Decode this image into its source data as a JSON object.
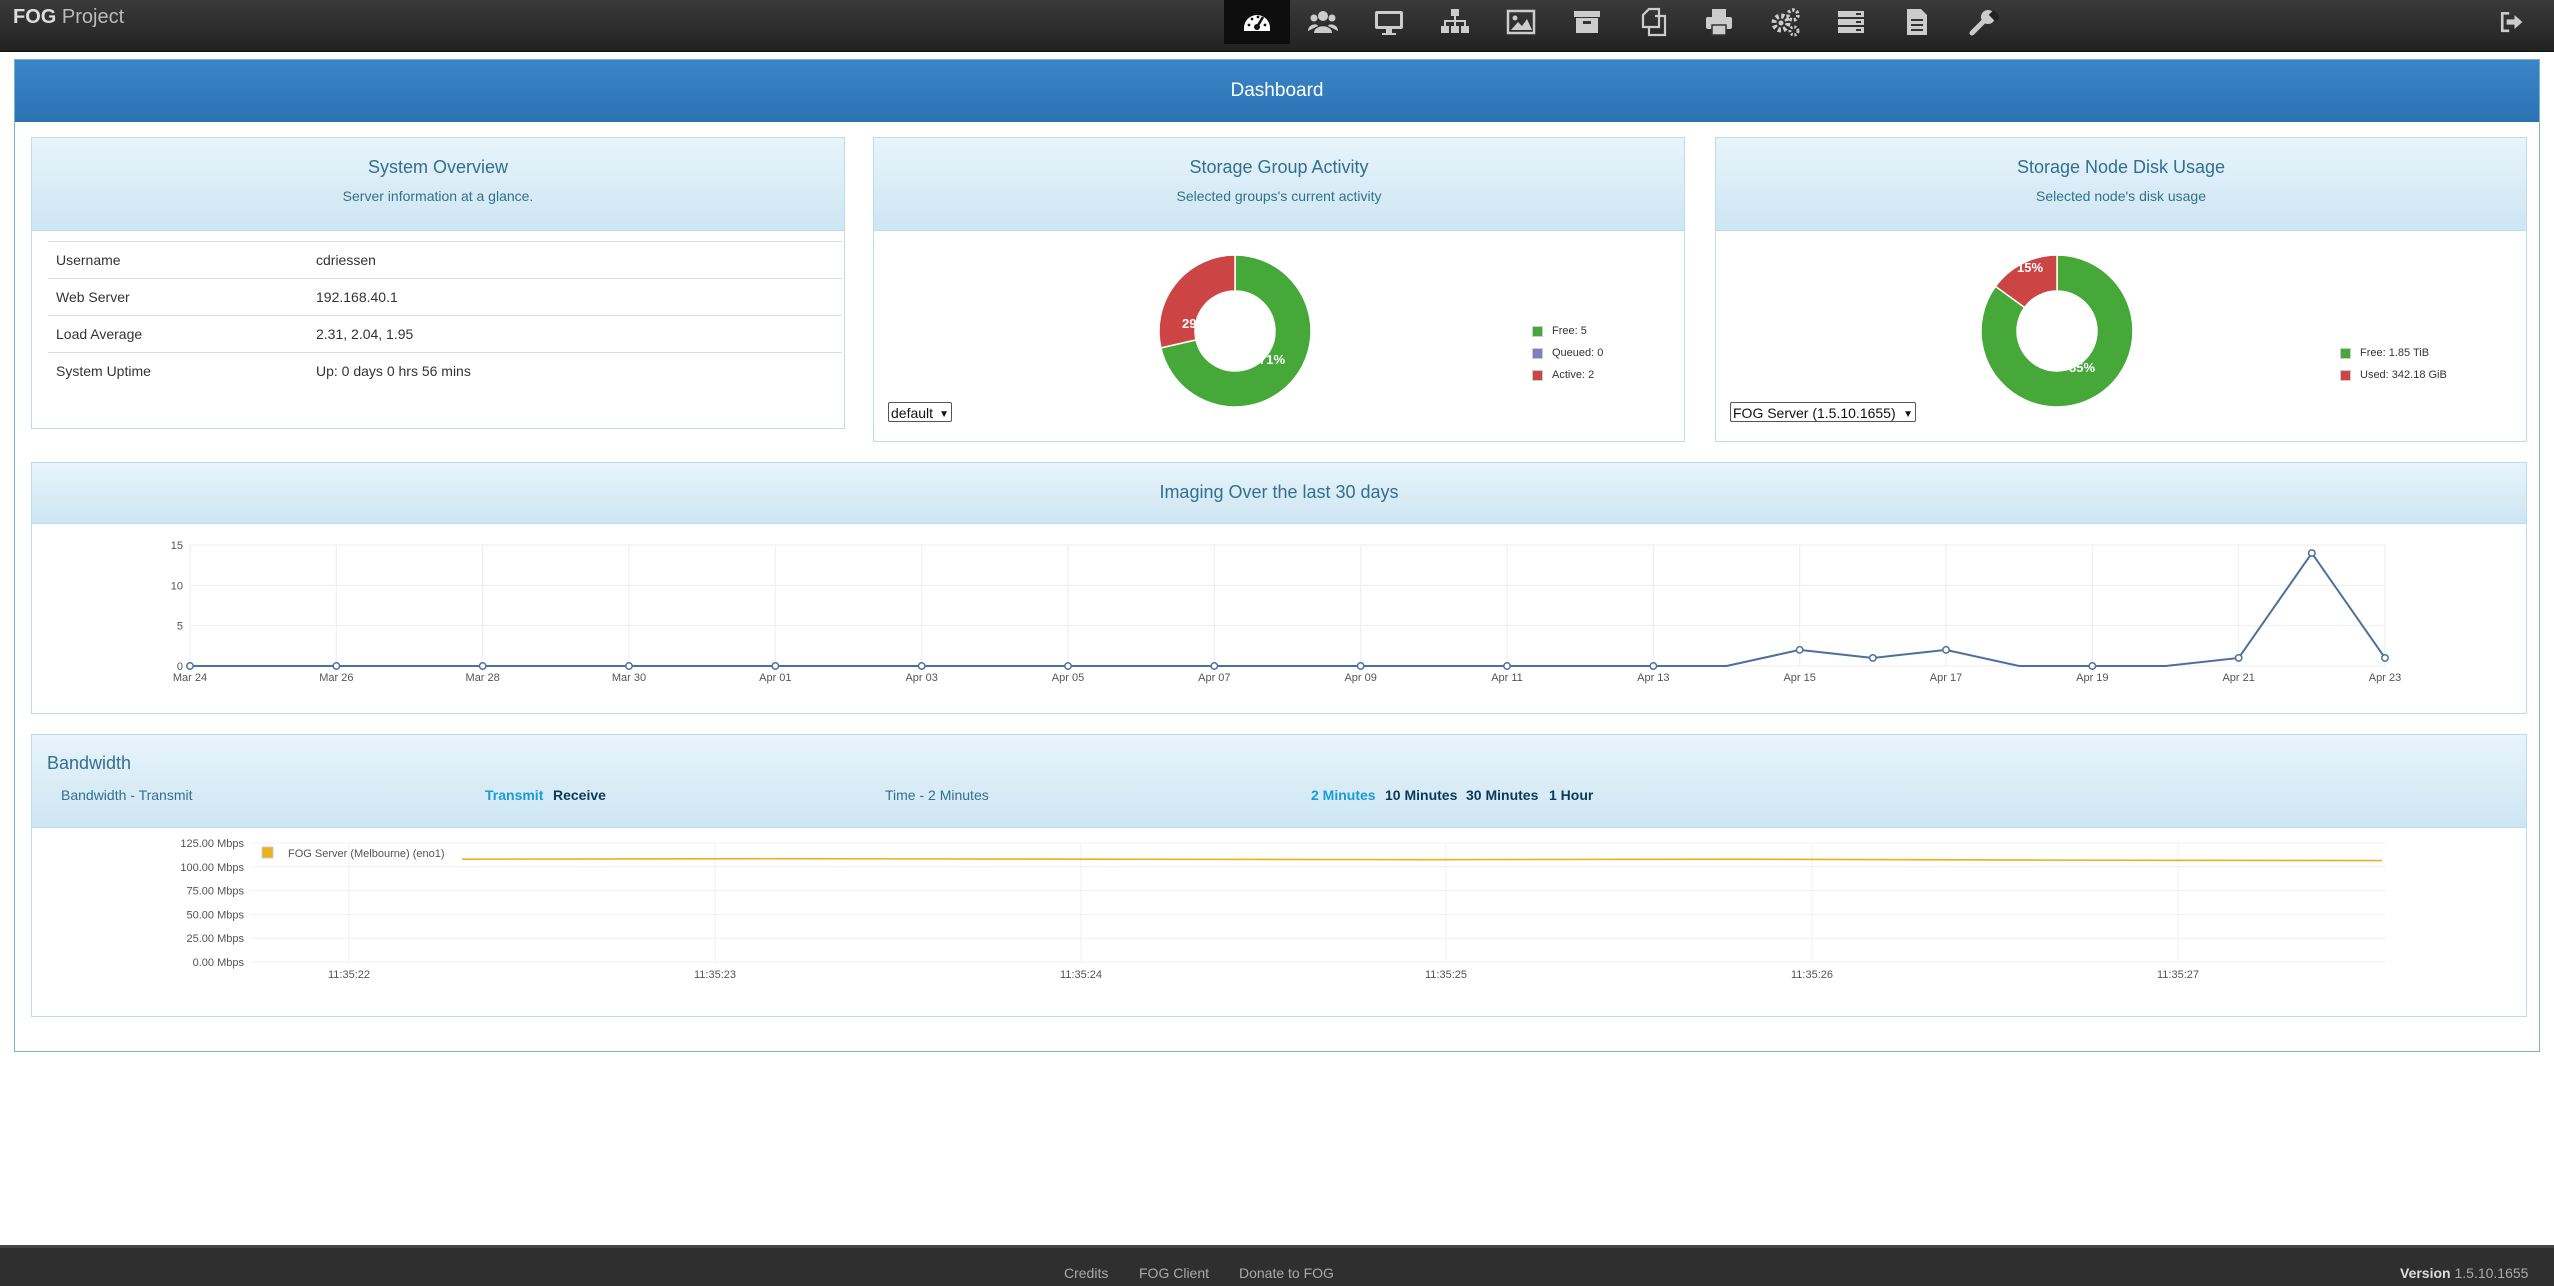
{
  "app": {
    "brand_bold": "FOG",
    "brand_rest": " Project"
  },
  "nav": {
    "items": [
      "dashboard-icon",
      "users-icon",
      "hosts-icon",
      "groups-icon",
      "images-icon",
      "storage-icon",
      "snapins-icon",
      "printers-icon",
      "services-icon",
      "tasks-icon",
      "reports-icon",
      "settings-icon"
    ],
    "active": "dashboard-icon",
    "logout": "logout-icon"
  },
  "dashboard": {
    "title": "Dashboard"
  },
  "system_overview": {
    "title": "System Overview",
    "subtitle": "Server information at a glance.",
    "rows": [
      {
        "key": "Username",
        "value": "cdriessen"
      },
      {
        "key": "Web Server",
        "value": "192.168.40.1"
      },
      {
        "key": "Load Average",
        "value": "2.31, 2.04, 1.95"
      },
      {
        "key": "System Uptime",
        "value": "Up: 0 days 0 hrs 56 mins"
      }
    ]
  },
  "storage_group": {
    "title": "Storage Group Activity",
    "subtitle": "Selected groups's current activity",
    "select_value": "default",
    "legend": [
      {
        "label": "Free: 5",
        "color": "#45a839"
      },
      {
        "label": "Queued: 0",
        "color": "#7f7fc0"
      },
      {
        "label": "Active: 2",
        "color": "#cc4444"
      }
    ],
    "pie_labels": {
      "free": "71%",
      "active": "29%"
    }
  },
  "storage_node": {
    "title": "Storage Node Disk Usage",
    "subtitle": "Selected node's disk usage",
    "select_value": "FOG Server (1.5.10.1655)",
    "legend": [
      {
        "label": "Free: 1.85 TiB",
        "color": "#45a839"
      },
      {
        "label": "Used: 342.18 GiB",
        "color": "#cc4444"
      }
    ],
    "pie_labels": {
      "free": "85%",
      "used": "15%"
    }
  },
  "imaging": {
    "title": "Imaging Over the last 30 days"
  },
  "bandwidth": {
    "title": "Bandwidth",
    "mode_label": "Bandwidth - Transmit",
    "tabs": [
      "Transmit",
      "Receive"
    ],
    "active_tab": "Transmit",
    "time_label": "Time - 2 Minutes",
    "time_tabs": [
      "2 Minutes",
      "10 Minutes",
      "30 Minutes",
      "1 Hour"
    ],
    "active_time": "2 Minutes"
  },
  "footer": {
    "links": [
      "Credits",
      "FOG Client",
      "Donate to FOG"
    ],
    "version_label": "Version",
    "version": "1.5.10.1655"
  },
  "colors": {
    "accent": "#2b72b2",
    "free": "#45a839",
    "used": "#cc4444",
    "queued": "#7f7fc0",
    "line": "#4d6f9e",
    "bandwidth": "#e8b21f"
  },
  "chart_data": [
    {
      "type": "pie",
      "title": "Storage Group Activity",
      "categories": [
        "Free",
        "Queued",
        "Active"
      ],
      "values": [
        5,
        0,
        2
      ]
    },
    {
      "type": "pie",
      "title": "Storage Node Disk Usage",
      "categories": [
        "Free",
        "Used"
      ],
      "values": [
        85,
        15
      ]
    },
    {
      "type": "line",
      "title": "Imaging Over the last 30 days",
      "x": [
        "Mar 24",
        "Mar 25",
        "Mar 26",
        "Mar 27",
        "Mar 28",
        "Mar 29",
        "Mar 30",
        "Mar 31",
        "Apr 01",
        "Apr 02",
        "Apr 03",
        "Apr 04",
        "Apr 05",
        "Apr 06",
        "Apr 07",
        "Apr 08",
        "Apr 09",
        "Apr 10",
        "Apr 11",
        "Apr 12",
        "Apr 13",
        "Apr 14",
        "Apr 15",
        "Apr 16",
        "Apr 17",
        "Apr 18",
        "Apr 19",
        "Apr 20",
        "Apr 21",
        "Apr 22",
        "Apr 23"
      ],
      "tick_labels": [
        "Mar 24",
        "Mar 26",
        "Mar 28",
        "Mar 30",
        "Apr 01",
        "Apr 03",
        "Apr 05",
        "Apr 07",
        "Apr 09",
        "Apr 11",
        "Apr 13",
        "Apr 15",
        "Apr 17",
        "Apr 19",
        "Apr 21",
        "Apr 23"
      ],
      "values": [
        0,
        0,
        0,
        0,
        0,
        0,
        0,
        0,
        0,
        0,
        0,
        0,
        0,
        0,
        0,
        0,
        0,
        0,
        0,
        0,
        0,
        0,
        2,
        1,
        2,
        0,
        0,
        0,
        1,
        14,
        1
      ],
      "ylim": [
        0,
        15
      ],
      "yticks": [
        0,
        5,
        10,
        15
      ],
      "grid": true
    },
    {
      "type": "line",
      "title": "Bandwidth - Transmit",
      "x_ticks": [
        "11:35:22",
        "11:35:23",
        "11:35:24",
        "11:35:25",
        "11:35:26",
        "11:35:27"
      ],
      "y_ticks": [
        "0.00 Mbps",
        "25.00 Mbps",
        "50.00 Mbps",
        "75.00 Mbps",
        "100.00 Mbps",
        "125.00 Mbps"
      ],
      "ylim": [
        0,
        125
      ],
      "series": [
        {
          "name": "FOG Server (Melbourne) (eno1)",
          "values": [
            108,
            108.5,
            108,
            107.5,
            108,
            107,
            106.5
          ]
        }
      ],
      "legend_position": "top-left",
      "grid": true
    }
  ]
}
